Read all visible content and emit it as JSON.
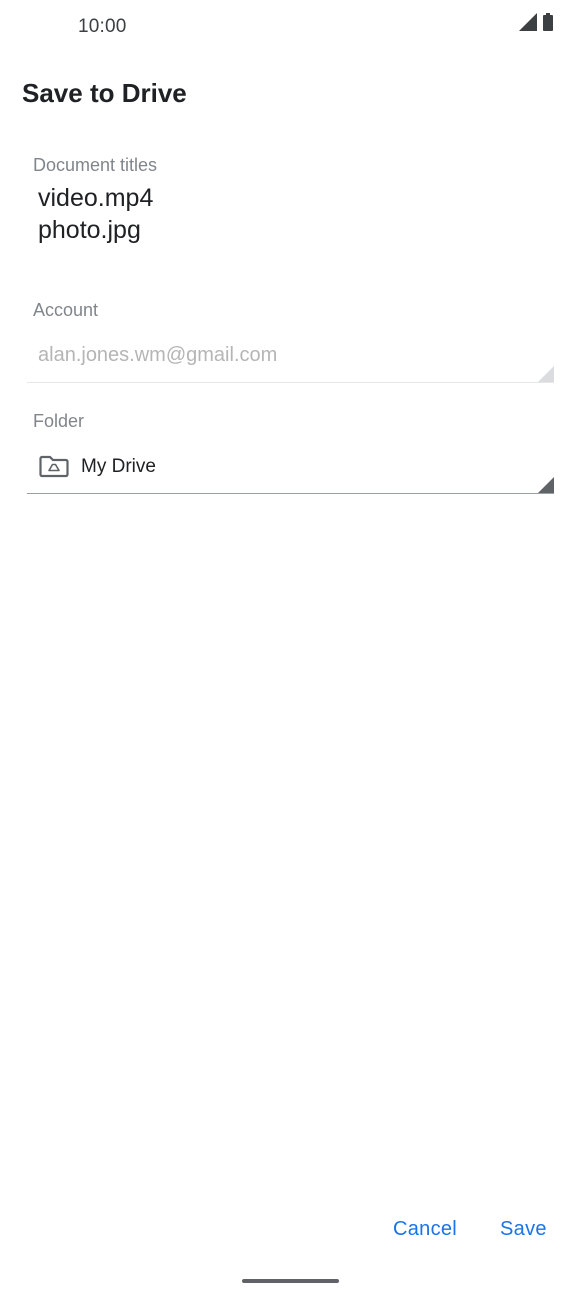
{
  "status_bar": {
    "time": "10:00",
    "icons": [
      "signal-icon",
      "battery-icon"
    ]
  },
  "dialog": {
    "title": "Save to Drive",
    "document_titles": {
      "label": "Document titles",
      "items": [
        "video.mp4",
        "photo.jpg"
      ]
    },
    "account": {
      "label": "Account",
      "value": "alan.jones.wm@gmail.com"
    },
    "folder": {
      "label": "Folder",
      "value": "My Drive",
      "icon": "drive-folder-icon"
    },
    "actions": {
      "cancel_label": "Cancel",
      "save_label": "Save"
    }
  },
  "colors": {
    "accent": "#1a73e8",
    "label": "#80868b",
    "disabled_text": "#b5b5b5"
  }
}
